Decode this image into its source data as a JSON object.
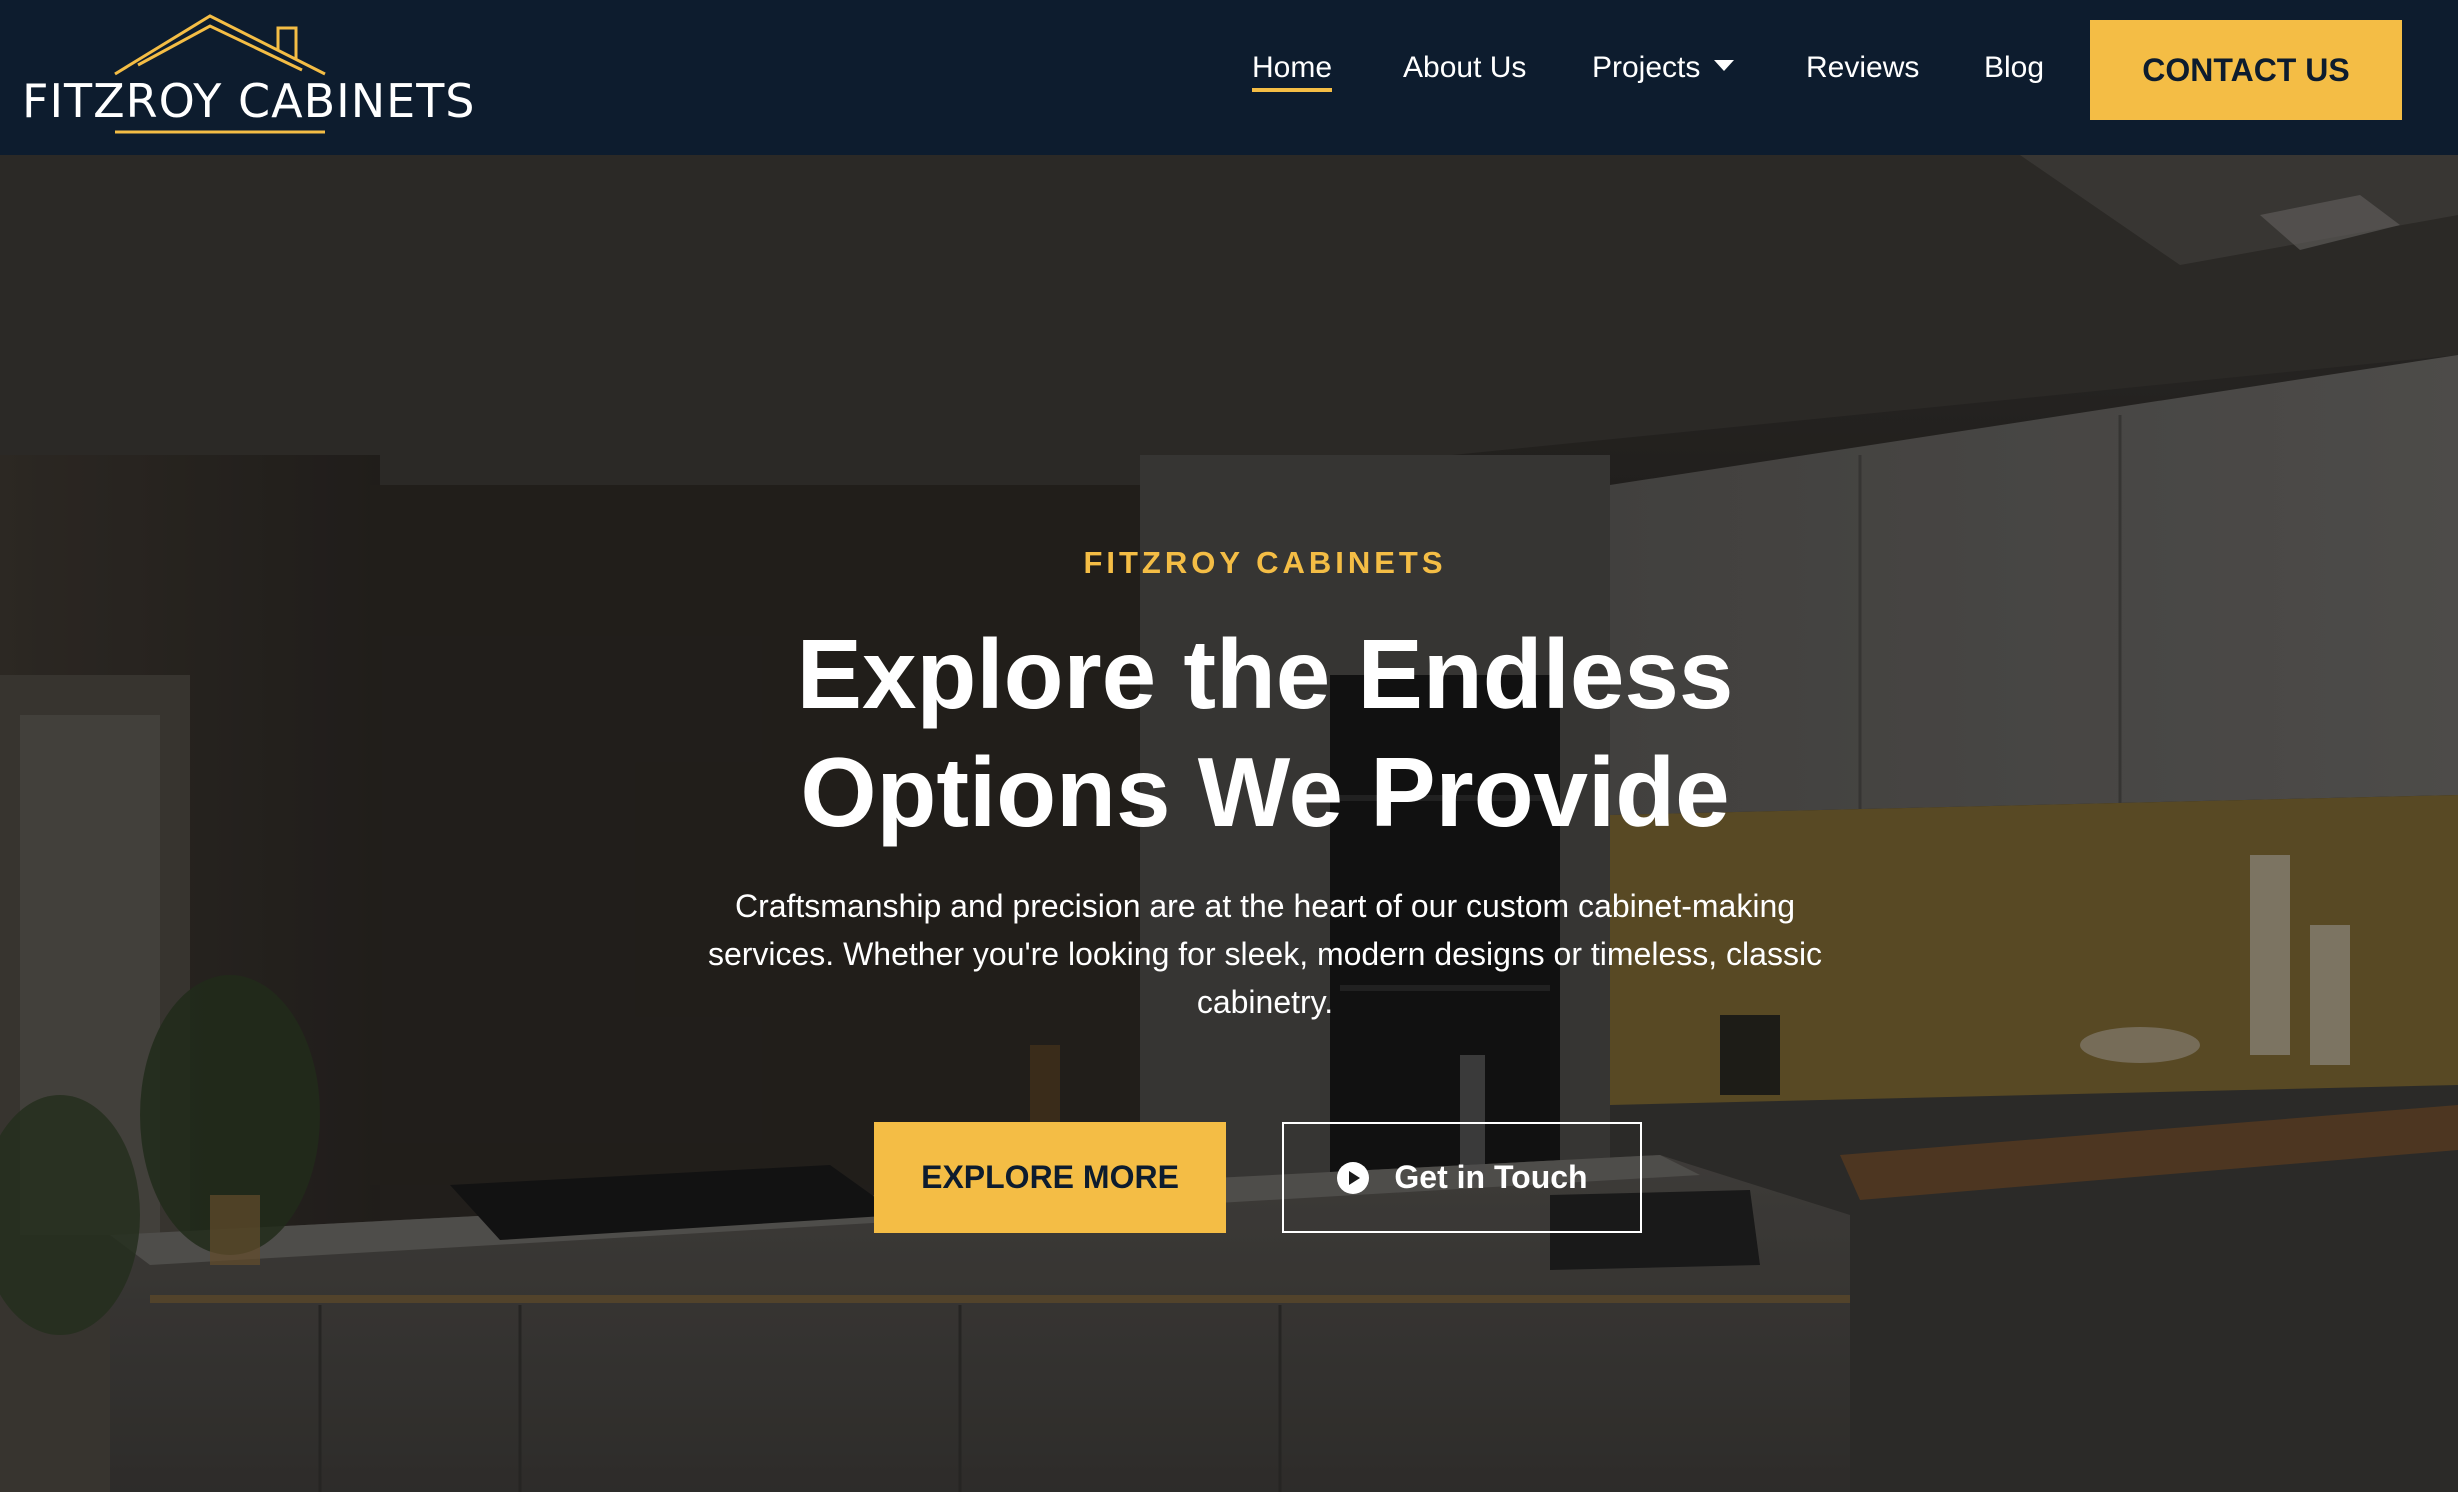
{
  "header": {
    "logo_text": "FITZROY CABINETS",
    "nav": [
      {
        "label": "Home"
      },
      {
        "label": "About Us"
      },
      {
        "label": "Projects"
      },
      {
        "label": "Reviews"
      },
      {
        "label": "Blog"
      }
    ],
    "contact_label": "CONTACT US"
  },
  "hero": {
    "eyebrow": "FITZROY CABINETS",
    "headline_line1": "Explore the Endless",
    "headline_line2": "Options We Provide",
    "subtext": "Craftsmanship and precision are at the heart of our custom cabinet-making services. Whether you're looking for sleek, modern designs or timeless, classic cabinetry.",
    "explore_label": "EXPLORE MORE",
    "touch_label": "Get in Touch"
  },
  "colors": {
    "navy": "#0d1c2e",
    "accent": "#f4bd45",
    "text_light": "#ffffff"
  },
  "icons": {
    "logo": "house-roof-icon",
    "projects_dropdown": "caret-down-icon",
    "get_in_touch": "play-circle-icon"
  }
}
